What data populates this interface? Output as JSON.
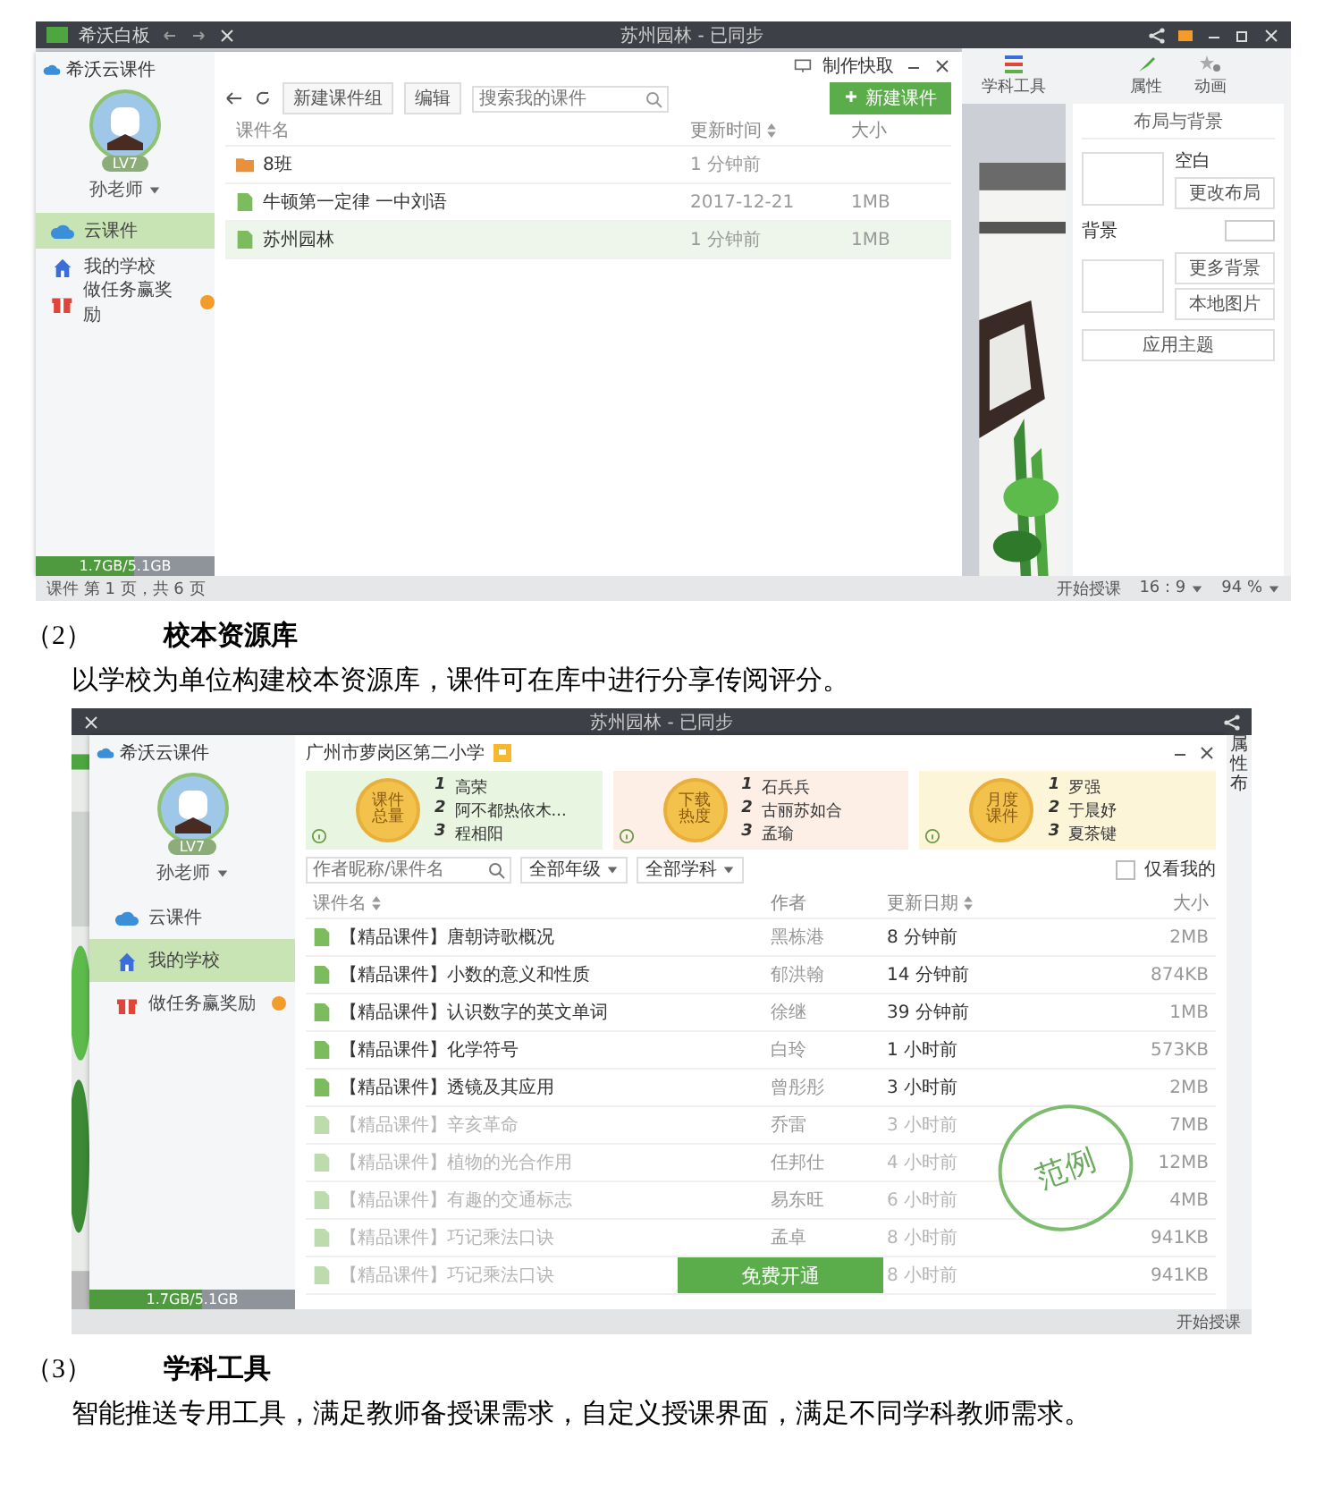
{
  "shot1": {
    "app_bar": {
      "app": "希沃白板",
      "document": "苏州园林 - 已同步"
    },
    "dialog": {
      "brand": "希沃云课件",
      "badge": "LV7",
      "user": "孙老师",
      "nav": [
        {
          "label": "云课件",
          "selected": true
        },
        {
          "label": "我的学校",
          "selected": false
        },
        {
          "label": "做任务赢奖励",
          "selected": false
        }
      ],
      "storage": {
        "text": "1.7GB/5.1GB",
        "level": 0.55
      },
      "capture": "制作快取",
      "toolbar": {
        "new_group": "新建课件组",
        "edit": "编辑",
        "search": {
          "placeholder": "搜索我的课件"
        },
        "new": "新建课件"
      },
      "columns": [
        {
          "label": "课件名",
          "sortable": false
        },
        {
          "label": "更新时间",
          "sortable": true
        },
        {
          "label": "大小",
          "sortable": false
        }
      ],
      "rows": [
        {
          "kind": "folder",
          "name": "8班",
          "updated": "1 分钟前",
          "selected": false
        },
        {
          "kind": "file",
          "name": "牛顿第一定律 一中刘语",
          "updated": "2017-12-21",
          "size": "1MB",
          "selected": false
        },
        {
          "kind": "file",
          "name": "苏州园林",
          "updated": "1 分钟前",
          "size": "1MB",
          "selected": true
        }
      ]
    },
    "tools": {
      "subject": "学科工具",
      "properties": "属性",
      "animation": "动画"
    },
    "panel": {
      "title": "布局与背景",
      "layout_name": "空白",
      "change_layout": "更改布局",
      "background": "背景",
      "more_backgrounds": "更多背景",
      "local_image": "本地图片",
      "apply_theme": "应用主题"
    },
    "status": {
      "page": "课件 第 1 页，共 6 页",
      "start": "开始授课",
      "ratio": "16 : 9",
      "zoom": "94 %"
    }
  },
  "section_2": {
    "number": "（2）",
    "title": "校本资源库",
    "text": "以学校为单位构建校本资源库，课件可在库中进行分享传阅评分。"
  },
  "shot2": {
    "app_bar": {
      "document": "苏州园林 - 已同步"
    },
    "dialog": {
      "brand": "希沃云课件",
      "badge": "LV7",
      "user": "孙老师",
      "nav": [
        {
          "label": "云课件",
          "selected": false
        },
        {
          "label": "我的学校",
          "selected": true
        },
        {
          "label": "做任务赢奖励",
          "selected": false
        }
      ],
      "storage": {
        "text": "1.7GB/5.1GB",
        "level": 0.55
      },
      "school": "广州市萝岗区第二小学",
      "rankings": [
        {
          "title": "课件总量",
          "color": "#e8f5e0",
          "names": [
            {
              "rank": "1",
              "name": "高荣"
            },
            {
              "rank": "2",
              "name": "阿不都热依木..."
            },
            {
              "rank": "3",
              "name": "程相阳"
            }
          ]
        },
        {
          "title": "下载热度",
          "color": "#fdeee6",
          "names": [
            {
              "rank": "1",
              "name": "石兵兵"
            },
            {
              "rank": "2",
              "name": "古丽苏如合"
            },
            {
              "rank": "3",
              "name": "孟瑜"
            }
          ]
        },
        {
          "title": "月度课件",
          "color": "#fdf5d8",
          "names": [
            {
              "rank": "1",
              "name": "罗强"
            },
            {
              "rank": "2",
              "name": "于晨妤"
            },
            {
              "rank": "3",
              "name": "夏茶键"
            }
          ]
        }
      ],
      "search": {
        "placeholder": "作者昵称/课件名"
      },
      "filters": [
        "全部年级",
        "全部学科"
      ],
      "mine_only": {
        "label": "仅看我的",
        "checked": false
      },
      "columns": [
        {
          "label": "课件名",
          "sortable": true
        },
        {
          "label": "作者",
          "sortable": false
        },
        {
          "label": "更新日期",
          "sortable": true
        },
        {
          "label": "大小",
          "sortable": false
        }
      ],
      "rows": [
        {
          "name": "【精品课件】唐朝诗歌概况",
          "author": "黑栋港",
          "updated": "8 分钟前",
          "size": "2MB",
          "dimmed": false
        },
        {
          "name": "【精品课件】小数的意义和性质",
          "author": "郁洪翰",
          "updated": "14 分钟前",
          "size": "874KB",
          "dimmed": false
        },
        {
          "name": "【精品课件】认识数字的英文单词",
          "author": "徐继",
          "updated": "39 分钟前",
          "size": "1MB",
          "dimmed": false
        },
        {
          "name": "【精品课件】化学符号",
          "author": "白玲",
          "updated": "1 小时前",
          "size": "573KB",
          "dimmed": false
        },
        {
          "name": "【精品课件】透镜及其应用",
          "author": "曾彤彤",
          "updated": "3 小时前",
          "size": "2MB",
          "dimmed": false
        },
        {
          "name": "【精品课件】辛亥革命",
          "author": "乔雷",
          "updated": "3 小时前",
          "size": "7MB",
          "dimmed": true
        },
        {
          "name": "【精品课件】植物的光合作用",
          "author": "任邦仕",
          "updated": "4 小时前",
          "size": "12MB",
          "dimmed": true
        },
        {
          "name": "【精品课件】有趣的交通标志",
          "author": "易东旺",
          "updated": "6 小时前",
          "size": "4MB",
          "dimmed": true
        },
        {
          "name": "【精品课件】巧记乘法口诀",
          "author": "孟卓",
          "updated": "8 小时前",
          "size": "941KB",
          "dimmed": true
        },
        {
          "name": "【精品课件】巧记乘法口诀",
          "updated": "8 小时前",
          "size": "941KB",
          "dimmed": true
        }
      ],
      "stamp": "范例",
      "open_button": "免费开通"
    },
    "side": {
      "properties": "属性",
      "panel_title": "布",
      "status": "开始授课"
    }
  },
  "section_3": {
    "number": "（3）",
    "title": "学科工具",
    "text": "智能推送专用工具，满足教师备授课需求，自定义授课界面，满足不同学科教师需求。"
  }
}
